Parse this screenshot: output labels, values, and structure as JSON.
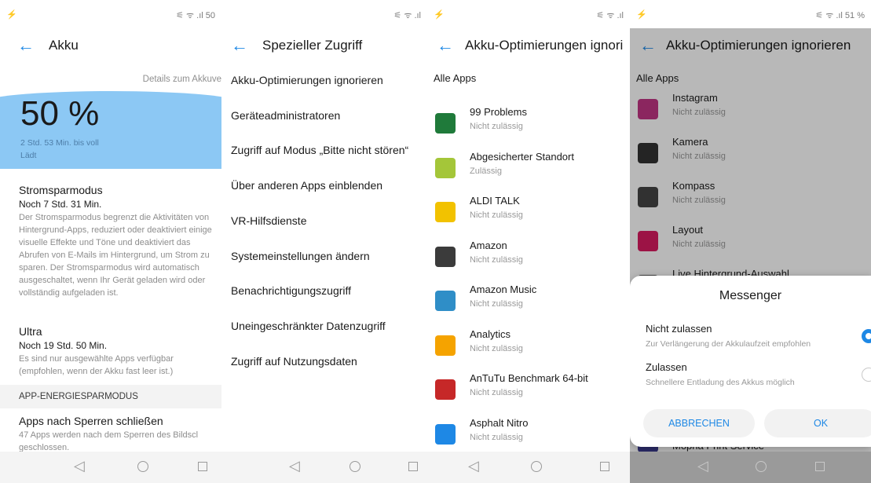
{
  "panel1": {
    "status_right": "⚟ ᯤ .ıl 50",
    "status_left": "⚡",
    "title": "Akku",
    "details_link": "Details zum Akkuve",
    "percent": "50 %",
    "charge_time": "2 Std. 53 Min. bis voll",
    "charge_state": "Lädt",
    "stromspar": {
      "title": "Stromsparmodus",
      "sub": "Noch 7 Std. 31 Min.",
      "desc": "Der Stromsparmodus begrenzt die Aktivitäten von Hintergrund-Apps, reduziert oder deaktiviert einige visuelle Effekte und Töne und deaktiviert das Abrufen von E-Mails im Hintergrund, um Strom zu sparen. Der Stromsparmodus wird automatisch ausgeschaltet, wenn Ihr Gerät geladen wird oder vollständig aufgeladen ist."
    },
    "ultra": {
      "title": "Ultra",
      "sub": "Noch 19 Std. 50 Min.",
      "desc": "Es sind nur ausgewählte Apps verfügbar (empfohlen, wenn der Akku fast leer ist.)"
    },
    "section_header": "APP-ENERGIESPARMODUS",
    "apps_close": {
      "title": "Apps nach Sperren schließen",
      "desc": "47 Apps werden nach dem Sperren des Bildscl geschlossen."
    }
  },
  "panel2": {
    "status_right": "⚟ ᯤ .ıl",
    "title": "Spezieller Zugriff",
    "items": [
      "Akku-Optimierungen ignorieren",
      "Geräteadministratoren",
      "Zugriff auf Modus „Bitte nicht stören“",
      "Über anderen Apps einblenden",
      "VR-Hilfsdienste",
      "Systemeinstellungen ändern",
      "Benachrichtigungszugriff",
      "Uneingeschränkter Datenzugriff",
      "Zugriff auf Nutzungsdaten"
    ]
  },
  "panel3": {
    "status_right": "⚟ ᯤ .ıl",
    "status_left": "⚡",
    "title": "Akku-Optimierungen ignori",
    "list_header": "Alle Apps",
    "apps": [
      {
        "name": "99 Problems",
        "status": "Nicht zulässig",
        "icon": "99-problems-icon",
        "color": "#1f7a3a"
      },
      {
        "name": "Abgesicherter Standort",
        "status": "Zulässig",
        "icon": "android-icon",
        "color": "#a4c639"
      },
      {
        "name": "ALDI TALK",
        "status": "Nicht zulässig",
        "icon": "aldi-talk-icon",
        "color": "#f2c200"
      },
      {
        "name": "Amazon",
        "status": "Nicht zulässig",
        "icon": "amazon-icon",
        "color": "#3b3b3b"
      },
      {
        "name": "Amazon Music",
        "status": "Nicht zulässig",
        "icon": "amazon-music-icon",
        "color": "#2f8ec7"
      },
      {
        "name": "Analytics",
        "status": "Nicht zulässig",
        "icon": "analytics-icon",
        "color": "#f5a300"
      },
      {
        "name": "AnTuTu Benchmark 64-bit",
        "status": "Nicht zulässig",
        "icon": "antutu-icon",
        "color": "#c62828"
      },
      {
        "name": "Asphalt Nitro",
        "status": "Nicht zulässig",
        "icon": "asphalt-nitro-icon",
        "color": "#1e88e5"
      }
    ]
  },
  "panel4": {
    "status_right": "⚟ ᯤ .ıl 51 %",
    "status_left": "⚡",
    "title": "Akku-Optimierungen ignorieren",
    "list_header": "Alle Apps",
    "apps": [
      {
        "name": "Instagram",
        "status": "Nicht zulässig",
        "icon": "instagram-icon",
        "color": "#c13584"
      },
      {
        "name": "Kamera",
        "status": "Nicht zulässig",
        "icon": "camera-icon",
        "color": "#333333"
      },
      {
        "name": "Kompass",
        "status": "Nicht zulässig",
        "icon": "compass-icon",
        "color": "#444444"
      },
      {
        "name": "Layout",
        "status": "Nicht zulässig",
        "icon": "layout-icon",
        "color": "#d81b60"
      },
      {
        "name": "Live Hintergrund-Auswahl",
        "status": "",
        "icon": "live-wallpaper-icon",
        "color": "#555555"
      }
    ],
    "bottom_app": "Mopria Print Service",
    "dialog": {
      "title": "Messenger",
      "option1_label": "Nicht zulassen",
      "option1_sub": "Zur Verlängerung der Akkulaufzeit empfohlen",
      "option2_label": "Zulassen",
      "option2_sub": "Schnellere Entladung des Akkus möglich",
      "cancel": "ABBRECHEN",
      "ok": "OK"
    }
  },
  "nav": {
    "back": "◁",
    "home": "",
    "recent": ""
  },
  "colors": {
    "accent": "#1e88e5",
    "battery_wave": "#8cc8f4"
  }
}
